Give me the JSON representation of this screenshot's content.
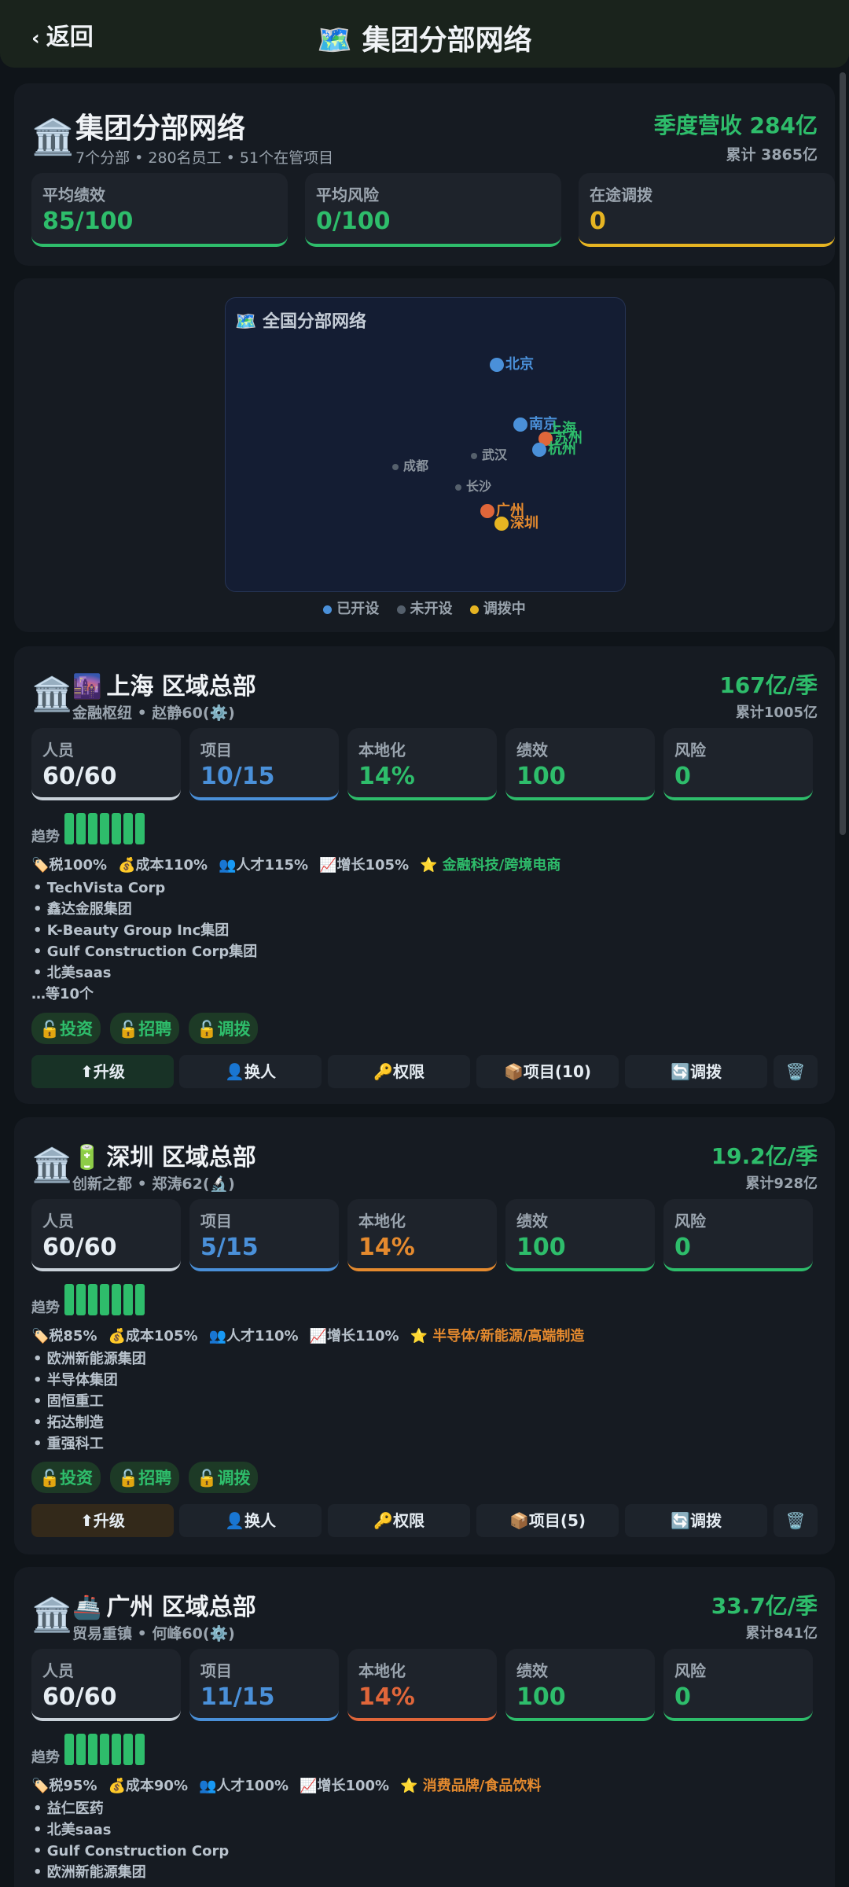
{
  "header": {
    "back_label": "返回",
    "title": "🗺️ 集团分部网络"
  },
  "summary": {
    "icon": "🏛️",
    "title": "集团分部网络",
    "subtitle": "7个分部 • 280名员工 • 51个在管项目",
    "revenue": "季度营收 284亿",
    "accumulated": "累计 3865亿",
    "stats": [
      {
        "label": "平均绩效",
        "value": "85/100",
        "color": "#2ebd6b"
      },
      {
        "label": "平均风险",
        "value": "0/100",
        "color": "#2ebd6b"
      },
      {
        "label": "在途调拨",
        "value": "0",
        "color": "#e6b422"
      }
    ]
  },
  "map": {
    "title": "🗺️ 全国分部网络",
    "cities_open": [
      "北京",
      "南京",
      "上海",
      "苏州",
      "杭州",
      "广州",
      "深圳"
    ],
    "cities_closed": [
      "武汉",
      "成都",
      "长沙"
    ],
    "legend": {
      "open": "已开设",
      "closed": "未开设",
      "transfer": "调拨中"
    },
    "colors": {
      "open": "#4a90d9",
      "closed": "#55606c",
      "transfer": "#e6b422"
    }
  },
  "branches": [
    {
      "icon": "🏛️",
      "emoji": "🌆",
      "title": "上海 区域总部",
      "sub": "金融枢纽 • 赵静60(⚙️)",
      "revenue": "167亿/季",
      "accumulated": "累计1005亿",
      "stats": [
        {
          "label": "人员",
          "value": "60/60",
          "color": "#e6edf3",
          "bar": "#c9d1d9"
        },
        {
          "label": "项目",
          "value": "10/15",
          "color": "#4a90d9",
          "bar": "#4a90d9"
        },
        {
          "label": "本地化",
          "value": "14%",
          "color": "#2ebd6b",
          "bar": "#2ebd6b"
        },
        {
          "label": "绩效",
          "value": "100",
          "color": "#2ebd6b",
          "bar": "#2ebd6b"
        },
        {
          "label": "风险",
          "value": "0",
          "color": "#2ebd6b",
          "bar": "#2ebd6b"
        }
      ],
      "trend_label": "趋势",
      "mods": [
        "🏷️税100%",
        "💰成本110%",
        "👥人才115%",
        "📈增长105%"
      ],
      "industry": "⭐ 金融科技/跨境电商",
      "industry_color": "#2ebd6b",
      "clients": [
        "• TechVista Corp",
        "• 鑫达金服集团",
        "• K-Beauty Group Inc集团",
        "• Gulf Construction Corp集团",
        "• 北美saas"
      ],
      "more": "…等10个",
      "tags": [
        "🔓投资",
        "🔓招聘",
        "🔓调拨"
      ],
      "actions": [
        "⬆升级",
        "👤换人",
        "🔑权限",
        "📦项目(10)",
        "🔄调拨",
        "🗑️"
      ],
      "upgrade_bg": "#183226"
    },
    {
      "icon": "🏛️",
      "emoji": "🔋",
      "title": "深圳 区域总部",
      "sub": "创新之都 • 郑涛62(🔬)",
      "revenue": "19.2亿/季",
      "accumulated": "累计928亿",
      "stats": [
        {
          "label": "人员",
          "value": "60/60",
          "color": "#e6edf3",
          "bar": "#c9d1d9"
        },
        {
          "label": "项目",
          "value": "5/15",
          "color": "#4a90d9",
          "bar": "#4a90d9"
        },
        {
          "label": "本地化",
          "value": "14%",
          "color": "#e58a2e",
          "bar": "#e58a2e"
        },
        {
          "label": "绩效",
          "value": "100",
          "color": "#2ebd6b",
          "bar": "#2ebd6b"
        },
        {
          "label": "风险",
          "value": "0",
          "color": "#2ebd6b",
          "bar": "#2ebd6b"
        }
      ],
      "trend_label": "趋势",
      "mods": [
        "🏷️税85%",
        "💰成本105%",
        "👥人才110%",
        "📈增长110%"
      ],
      "industry": "⭐ 半导体/新能源/高端制造",
      "industry_color": "#e58a2e",
      "clients": [
        "• 欧洲新能源集团",
        "• 半导体集团",
        "• 固恒重工",
        "• 拓达制造",
        "• 重强科工"
      ],
      "more": "",
      "tags": [
        "🔓投资",
        "🔓招聘",
        "🔓调拨"
      ],
      "actions": [
        "⬆升级",
        "👤换人",
        "🔑权限",
        "📦项目(5)",
        "🔄调拨",
        "🗑️"
      ],
      "upgrade_bg": "#33291a"
    },
    {
      "icon": "🏛️",
      "emoji": "🚢",
      "title": "广州 区域总部",
      "sub": "贸易重镇 • 何峰60(⚙️)",
      "revenue": "33.7亿/季",
      "accumulated": "累计841亿",
      "stats": [
        {
          "label": "人员",
          "value": "60/60",
          "color": "#e6edf3",
          "bar": "#c9d1d9"
        },
        {
          "label": "项目",
          "value": "11/15",
          "color": "#4a90d9",
          "bar": "#4a90d9"
        },
        {
          "label": "本地化",
          "value": "14%",
          "color": "#e0663a",
          "bar": "#e0663a"
        },
        {
          "label": "绩效",
          "value": "100",
          "color": "#2ebd6b",
          "bar": "#2ebd6b"
        },
        {
          "label": "风险",
          "value": "0",
          "color": "#2ebd6b",
          "bar": "#2ebd6b"
        }
      ],
      "trend_label": "趋势",
      "mods": [
        "🏷️税95%",
        "💰成本90%",
        "👥人才100%",
        "📈增长100%"
      ],
      "industry": "⭐ 消费品牌/食品饮料",
      "industry_color": "#e58a2e",
      "clients": [
        "• 益仁医药",
        "• 北美saas",
        "• Gulf Construction Corp",
        "• 欧洲新能源集团"
      ],
      "more": "",
      "tags": [],
      "actions": [],
      "upgrade_bg": "#183226"
    }
  ]
}
